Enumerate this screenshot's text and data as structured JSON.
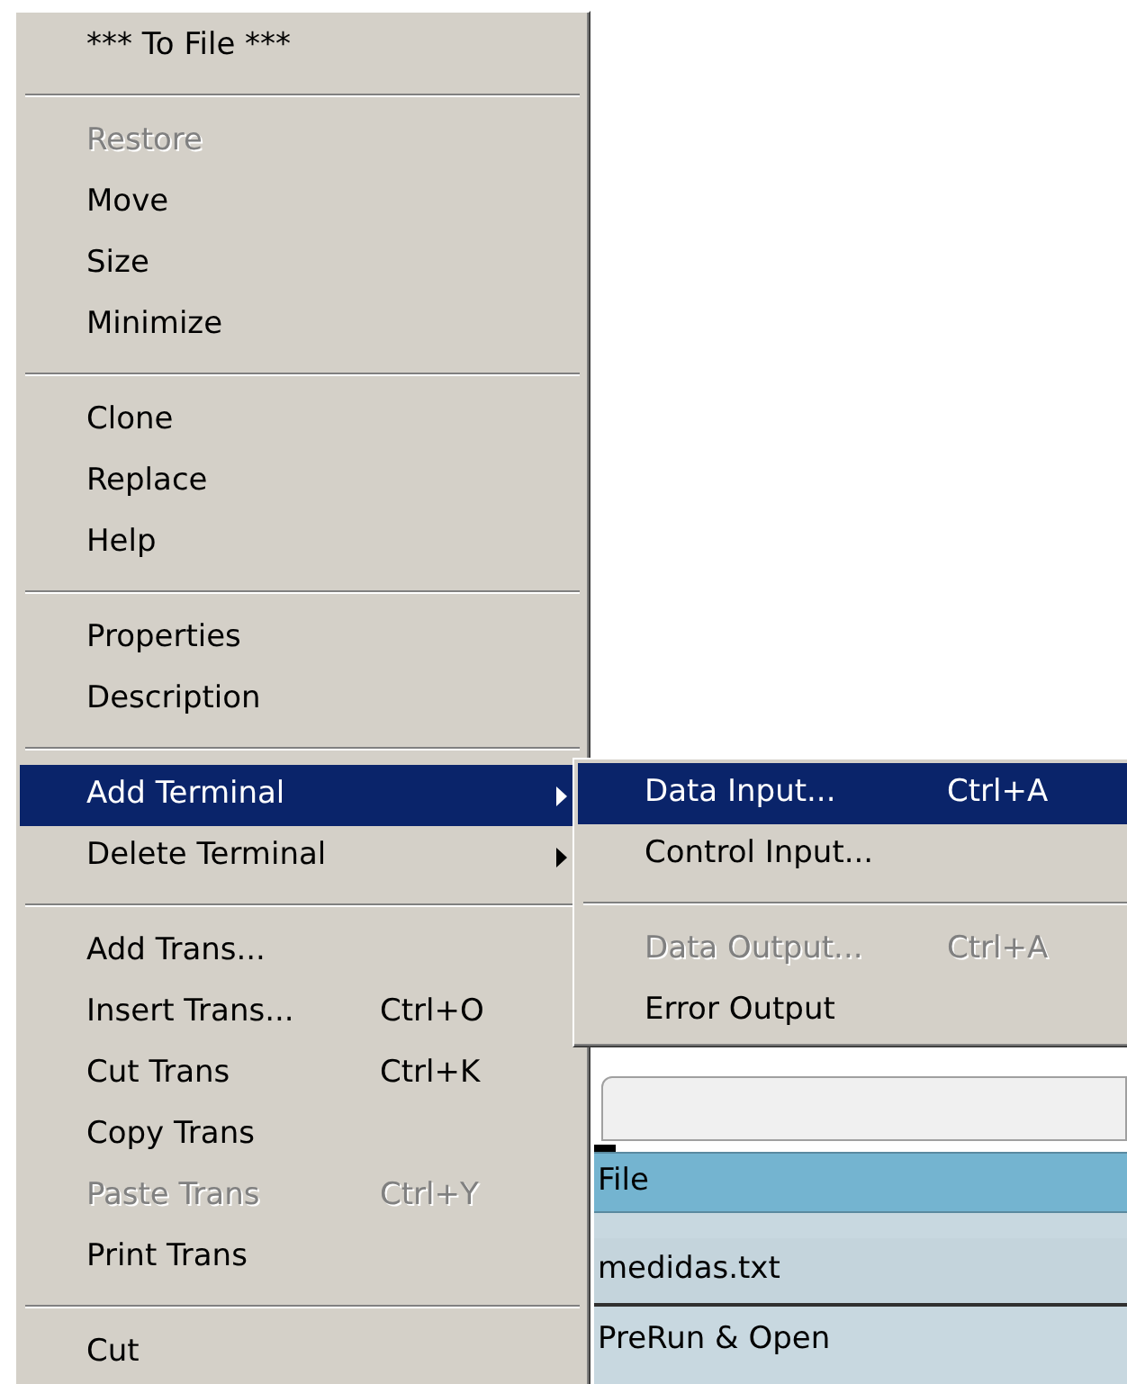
{
  "menu": {
    "items": [
      {
        "kind": "item",
        "label": "*** To File ***",
        "disabled": false,
        "selected": false
      },
      {
        "kind": "separator"
      },
      {
        "kind": "item",
        "label": "Restore",
        "disabled": true,
        "selected": false
      },
      {
        "kind": "item",
        "label": "Move",
        "disabled": false,
        "selected": false
      },
      {
        "kind": "item",
        "label": "Size",
        "disabled": false,
        "selected": false
      },
      {
        "kind": "item",
        "label": "Minimize",
        "disabled": false,
        "selected": false
      },
      {
        "kind": "separator"
      },
      {
        "kind": "item",
        "label": "Clone",
        "disabled": false,
        "selected": false
      },
      {
        "kind": "item",
        "label": "Replace",
        "disabled": false,
        "selected": false
      },
      {
        "kind": "item",
        "label": "Help",
        "disabled": false,
        "selected": false
      },
      {
        "kind": "separator"
      },
      {
        "kind": "item",
        "label": "Properties",
        "disabled": false,
        "selected": false
      },
      {
        "kind": "item",
        "label": "Description",
        "disabled": false,
        "selected": false
      },
      {
        "kind": "separator"
      },
      {
        "kind": "item",
        "label": "Add Terminal",
        "disabled": false,
        "selected": true,
        "has_submenu": true
      },
      {
        "kind": "item",
        "label": "Delete Terminal",
        "disabled": false,
        "selected": false,
        "has_submenu": true
      },
      {
        "kind": "separator"
      },
      {
        "kind": "item",
        "label": "Add Trans...",
        "disabled": false,
        "selected": false
      },
      {
        "kind": "item",
        "label": "Insert Trans...",
        "shortcut": "Ctrl+O",
        "disabled": false,
        "selected": false
      },
      {
        "kind": "item",
        "label": "Cut Trans",
        "shortcut": "Ctrl+K",
        "disabled": false,
        "selected": false
      },
      {
        "kind": "item",
        "label": "Copy Trans",
        "disabled": false,
        "selected": false
      },
      {
        "kind": "item",
        "label": "Paste Trans",
        "shortcut": "Ctrl+Y",
        "disabled": true,
        "selected": false
      },
      {
        "kind": "item",
        "label": "Print Trans",
        "disabled": false,
        "selected": false
      },
      {
        "kind": "separator"
      },
      {
        "kind": "item",
        "label": "Cut",
        "disabled": false,
        "selected": false
      }
    ]
  },
  "submenu": {
    "items": [
      {
        "kind": "item",
        "label": "Data Input...",
        "shortcut": "Ctrl+A",
        "disabled": false,
        "selected": true
      },
      {
        "kind": "item",
        "label": "Control Input...",
        "disabled": false,
        "selected": false
      },
      {
        "kind": "separator"
      },
      {
        "kind": "item",
        "label": "Data Output...",
        "shortcut": "Ctrl+A",
        "disabled": true,
        "selected": false
      },
      {
        "kind": "item",
        "label": "Error Output",
        "disabled": false,
        "selected": false
      }
    ]
  },
  "background": {
    "section_header": "File",
    "file_name": "medidas.txt",
    "button": "PreRun & Open"
  }
}
